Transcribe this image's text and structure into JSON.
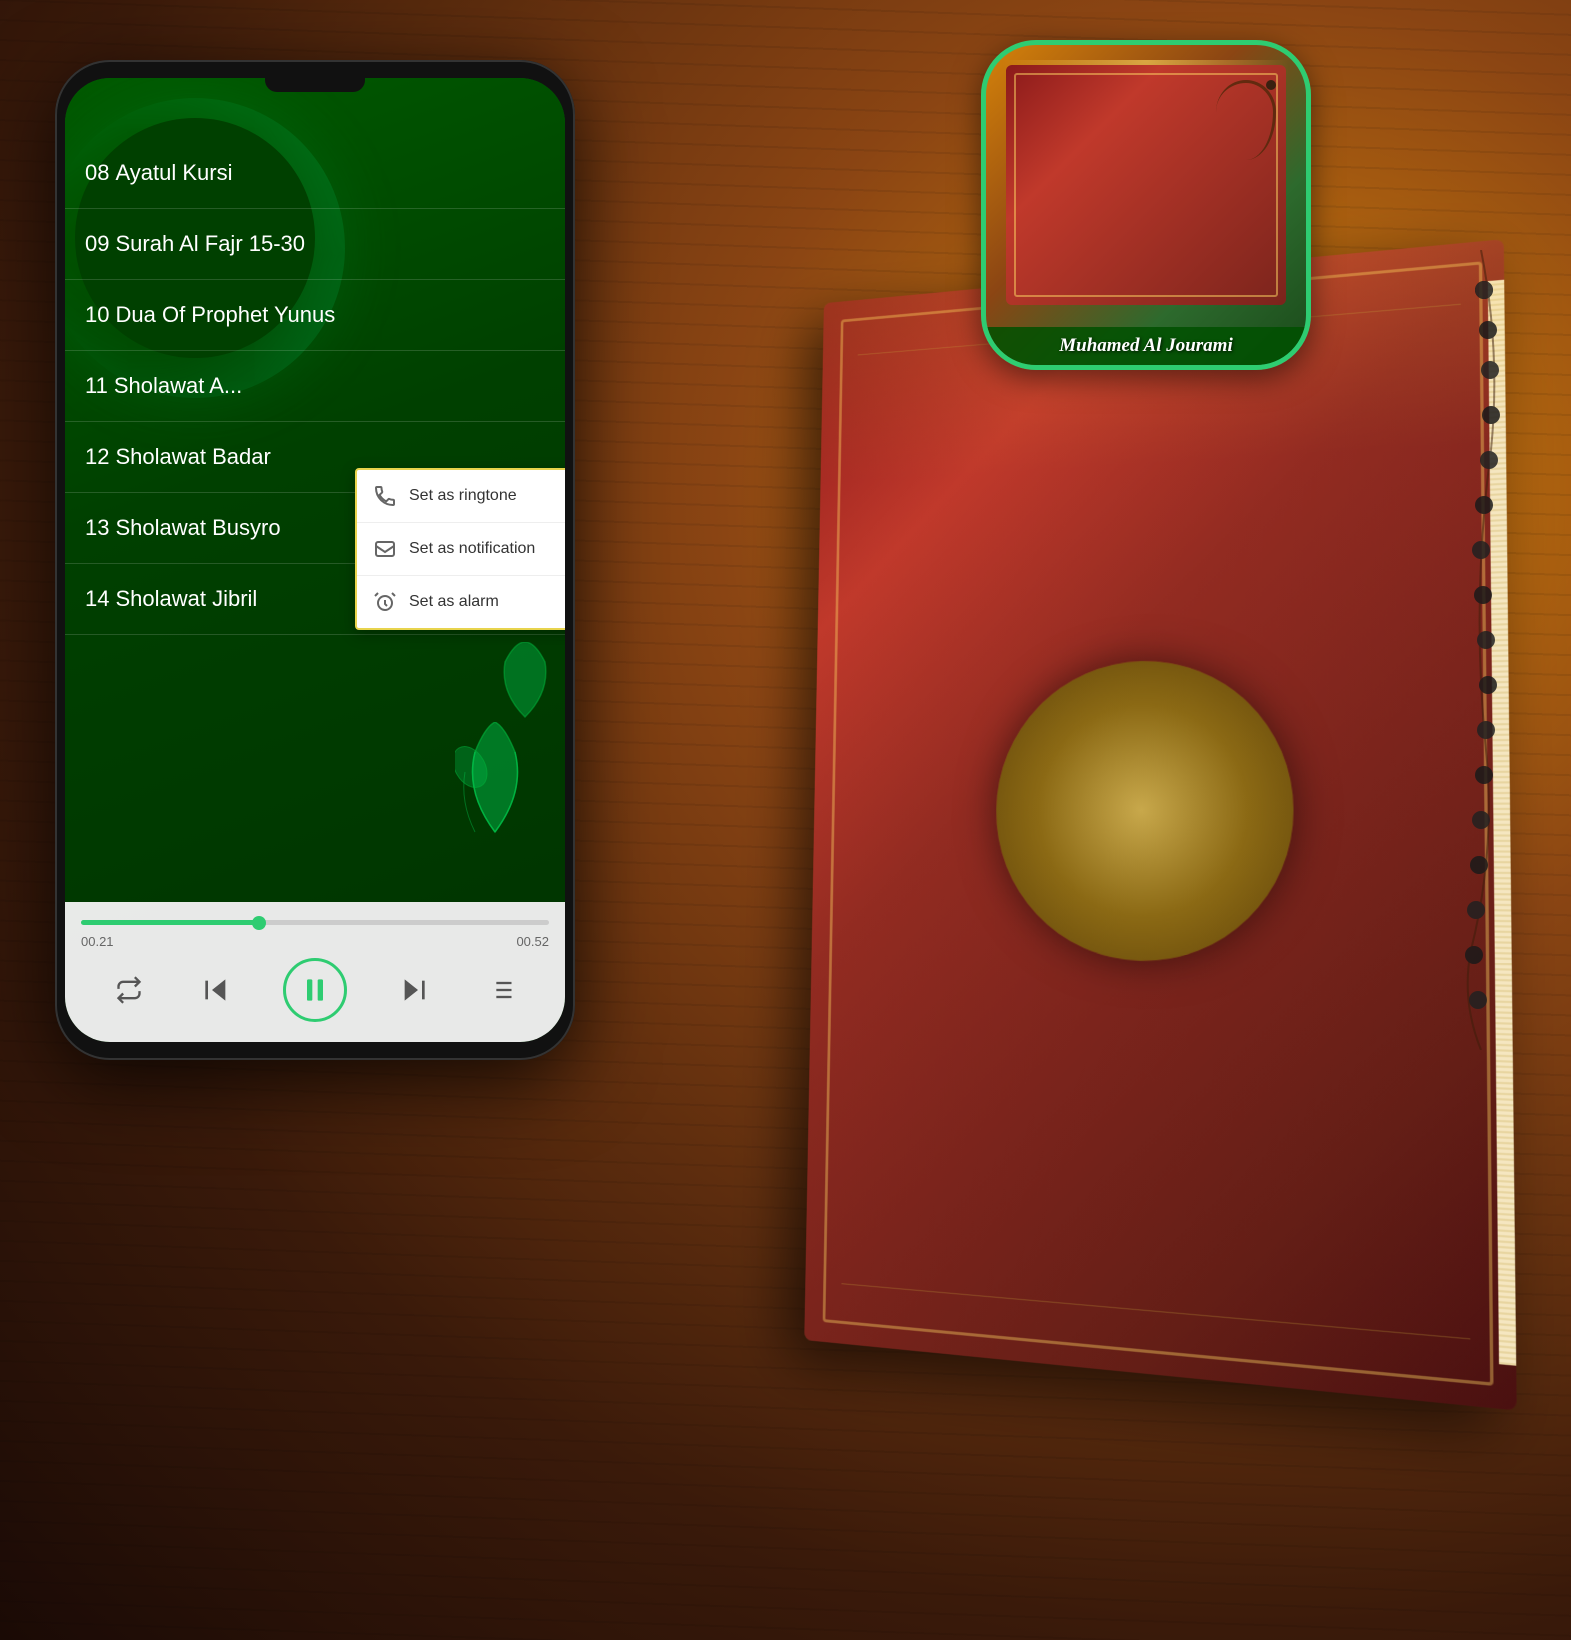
{
  "app": {
    "title": "Muhamed Al Jourami",
    "app_icon_title": "Muhamed Al Jourami"
  },
  "songs": [
    {
      "id": "08",
      "title": "Ayatul Kursi"
    },
    {
      "id": "09",
      "title": "Surah Al Fajr 15-30"
    },
    {
      "id": "10",
      "title": "Dua Of Prophet Yunus"
    },
    {
      "id": "11",
      "title": "Sholawat A..."
    },
    {
      "id": "12",
      "title": "Sholawat Badar"
    },
    {
      "id": "13",
      "title": "Sholawat Busyro"
    },
    {
      "id": "14",
      "title": "Sholawat Jibril"
    }
  ],
  "context_menu": {
    "items": [
      {
        "id": "ringtone",
        "label": "Set as ringtone",
        "icon": "phone-ring-icon"
      },
      {
        "id": "notification",
        "label": "Set as notification",
        "icon": "notification-icon"
      },
      {
        "id": "alarm",
        "label": "Set as alarm",
        "icon": "alarm-icon"
      }
    ]
  },
  "player": {
    "time_current": "00.21",
    "time_total": "00.52",
    "progress_percent": 38
  },
  "controls": {
    "repeat_label": "repeat",
    "prev_label": "previous",
    "play_pause_label": "pause",
    "next_label": "next",
    "playlist_label": "playlist"
  }
}
